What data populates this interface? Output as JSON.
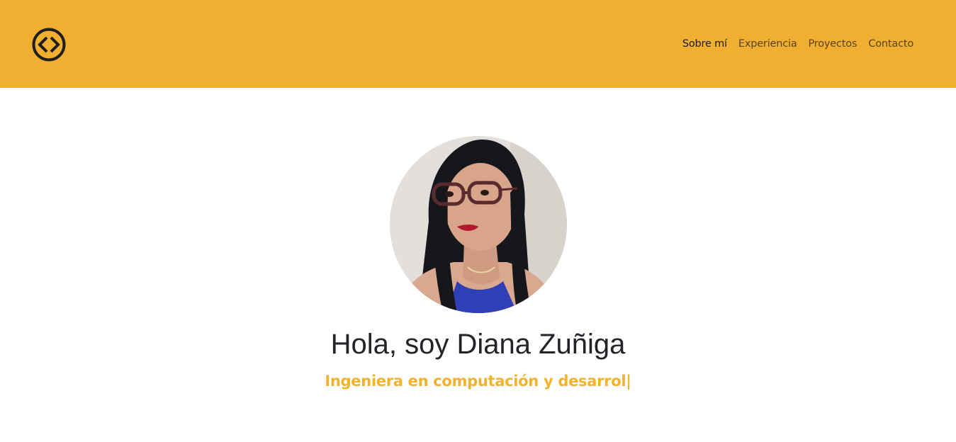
{
  "header": {
    "background_color": "#f0af30",
    "logo_icon": "code-brackets-icon",
    "nav": [
      {
        "label": "Sobre mí",
        "active": true
      },
      {
        "label": "Experiencia",
        "active": false
      },
      {
        "label": "Proyectos",
        "active": false
      },
      {
        "label": "Contacto",
        "active": false
      }
    ]
  },
  "hero": {
    "avatar_icon": "profile-photo",
    "title": "Hola, soy Diana Zuñiga",
    "subtitle": "Ingeniera en computación y desarrol|",
    "accent_color": "#f2b22a"
  }
}
